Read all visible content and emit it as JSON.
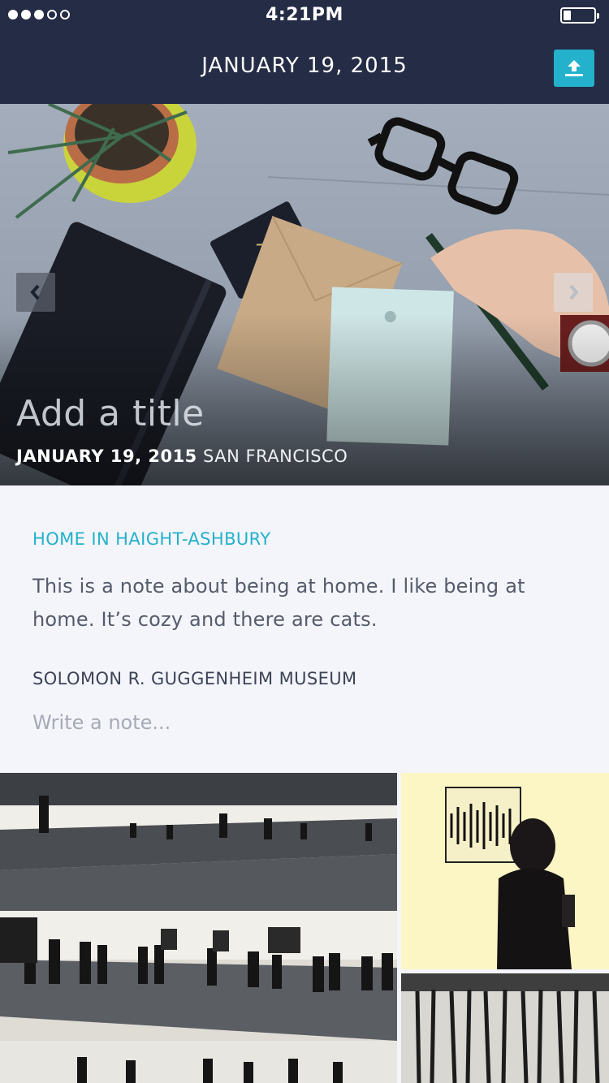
{
  "status_bar": {
    "time": "4:21PM"
  },
  "nav": {
    "title": "JANUARY 19, 2015"
  },
  "hero": {
    "title": "Add a title",
    "date": "JANUARY 19, 2015",
    "location": "SAN FRANCISCO"
  },
  "notes": [
    {
      "place": "HOME IN HAIGHT-ASHBURY",
      "text": "This is a note about being at home. I like being at home. It’s cozy and there are cats."
    },
    {
      "place": "SOLOMON R. GUGGENHEIM MUSEUM",
      "placeholder": "Write a note..."
    }
  ],
  "colors": {
    "nav_bg": "#252c45",
    "accent": "#23b1cb",
    "page_bg": "#f4f5fb"
  },
  "icons": [
    "upload-icon",
    "chevron-left-icon",
    "chevron-right-icon"
  ]
}
